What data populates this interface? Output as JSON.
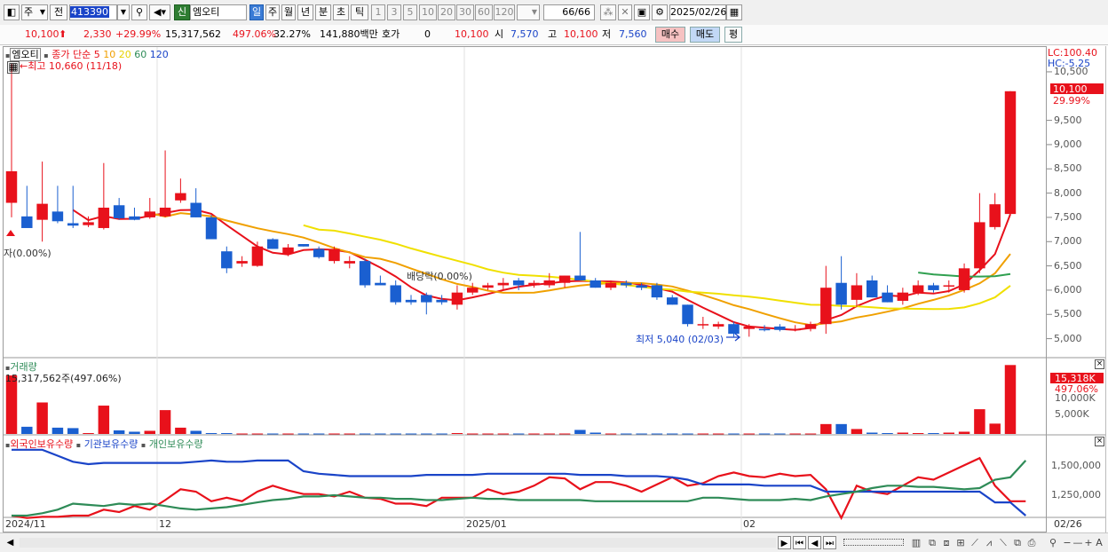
{
  "toolbar": {
    "mode": "주",
    "prev_label": "전",
    "code": "413390",
    "badge": "신",
    "name": "엠오티",
    "periods": [
      "일",
      "주",
      "월",
      "년",
      "분",
      "초",
      "틱"
    ],
    "selected_period": "일",
    "numbers": [
      "1",
      "3",
      "5",
      "10",
      "20",
      "30",
      "60",
      "120"
    ],
    "count": "66/66",
    "date": "2025/02/26"
  },
  "infobar": {
    "price": "10,100",
    "change": "2,330",
    "change_pct": "+29.99%",
    "volume": "15,317,562",
    "volume_pct": "497.06%",
    "turnover_pct": "32.27%",
    "amount": "141,880백만",
    "quote_label": "호가",
    "quote_value": "0",
    "close_value": "10,100",
    "open_label": "시",
    "open_value": "7,570",
    "high_label": "고",
    "high_value": "10,100",
    "low_label": "저",
    "low_value": "7,560",
    "buy_label": "매수",
    "sell_label": "매도",
    "eval_label": "평"
  },
  "price_pane": {
    "legend_name": "엠오티",
    "legend_ma_label": "종가 단순",
    "ma_periods": [
      "5",
      "10",
      "20",
      "60",
      "120"
    ],
    "ma_colors": [
      "#e8111b",
      "#f0a000",
      "#f0e000",
      "#30a050",
      "#1a44c8"
    ],
    "lc": "LC:100.40",
    "hc": "HC:-5.25",
    "high_annotation": "←최고 10,660 (11/18)",
    "low_annotation": "최저 5,040 (02/03)",
    "left_annotation": "자(0.00%)",
    "dividend_annotation": "배당락(0.00%)",
    "current_price": "10,100",
    "current_pct": "29.99%",
    "y_ticks": [
      "10,500",
      "9,500",
      "9,000",
      "8,500",
      "8,000",
      "7,500",
      "7,000",
      "6,500",
      "6,000",
      "5,500",
      "5,000"
    ]
  },
  "volume_pane": {
    "title": "거래량",
    "value_label": "15,317,562주(497.06%)",
    "current": "15,318K",
    "current_pct": "497.06%",
    "y_ticks": [
      "10,000K",
      "5,000K"
    ]
  },
  "holdings_pane": {
    "series": [
      "외국인보유수량",
      "기관보유수량",
      "개인보유수량"
    ],
    "colors": [
      "#e8111b",
      "#1a44c8",
      "#2e8b57"
    ],
    "y_ticks": [
      "1,500,000",
      "1,250,000"
    ]
  },
  "x_axis": {
    "labels": [
      "2024/11",
      "12",
      "2025/01",
      "02"
    ],
    "end_label": "02/26"
  },
  "chart_data": {
    "type": "candlestick",
    "candles": [
      {
        "d": "11/14",
        "o": 7800,
        "h": 10660,
        "l": 7500,
        "c": 8450
      },
      {
        "d": "11/15",
        "o": 7520,
        "h": 8150,
        "l": 7350,
        "c": 7280
      },
      {
        "d": "11/18",
        "o": 7450,
        "h": 8650,
        "l": 7000,
        "c": 7780
      },
      {
        "d": "11/19",
        "o": 7620,
        "h": 8150,
        "l": 7380,
        "c": 7420
      },
      {
        "d": "11/20",
        "o": 7380,
        "h": 8150,
        "l": 7280,
        "c": 7330
      },
      {
        "d": "11/21",
        "o": 7340,
        "h": 7520,
        "l": 7300,
        "c": 7400
      },
      {
        "d": "11/22",
        "o": 7280,
        "h": 8620,
        "l": 7250,
        "c": 7700
      },
      {
        "d": "11/25",
        "o": 7750,
        "h": 7900,
        "l": 7450,
        "c": 7480
      },
      {
        "d": "11/26",
        "o": 7520,
        "h": 7700,
        "l": 7440,
        "c": 7450
      },
      {
        "d": "11/27",
        "o": 7500,
        "h": 7900,
        "l": 7470,
        "c": 7620
      },
      {
        "d": "11/28",
        "o": 7520,
        "h": 8880,
        "l": 7500,
        "c": 7700
      },
      {
        "d": "11/29",
        "o": 7850,
        "h": 8300,
        "l": 7800,
        "c": 8000
      },
      {
        "d": "12/02",
        "o": 7800,
        "h": 8100,
        "l": 7500,
        "c": 7500
      },
      {
        "d": "12/03",
        "o": 7500,
        "h": 7550,
        "l": 7140,
        "c": 7050
      },
      {
        "d": "12/04",
        "o": 6800,
        "h": 6900,
        "l": 6350,
        "c": 6450
      },
      {
        "d": "12/05",
        "o": 6550,
        "h": 6700,
        "l": 6480,
        "c": 6600
      },
      {
        "d": "12/06",
        "o": 6500,
        "h": 7000,
        "l": 6480,
        "c": 6900
      },
      {
        "d": "12/09",
        "o": 7050,
        "h": 7070,
        "l": 6850,
        "c": 6850
      },
      {
        "d": "12/10",
        "o": 6750,
        "h": 6950,
        "l": 6700,
        "c": 6880
      },
      {
        "d": "12/11",
        "o": 6950,
        "h": 6950,
        "l": 6900,
        "c": 6900
      },
      {
        "d": "12/12",
        "o": 6850,
        "h": 6900,
        "l": 6650,
        "c": 6680
      },
      {
        "d": "12/13",
        "o": 6600,
        "h": 6900,
        "l": 6550,
        "c": 6850
      },
      {
        "d": "12/16",
        "o": 6550,
        "h": 6700,
        "l": 6450,
        "c": 6600
      },
      {
        "d": "12/17",
        "o": 6600,
        "h": 6650,
        "l": 6050,
        "c": 6100
      },
      {
        "d": "12/18",
        "o": 6150,
        "h": 6300,
        "l": 6100,
        "c": 6100
      },
      {
        "d": "12/19",
        "o": 6100,
        "h": 6200,
        "l": 5700,
        "c": 5750
      },
      {
        "d": "12/20",
        "o": 5800,
        "h": 5900,
        "l": 5700,
        "c": 5750
      },
      {
        "d": "12/23",
        "o": 5900,
        "h": 5950,
        "l": 5500,
        "c": 5750
      },
      {
        "d": "12/24",
        "o": 5800,
        "h": 5900,
        "l": 5700,
        "c": 5750
      },
      {
        "d": "12/26",
        "o": 5700,
        "h": 6100,
        "l": 5600,
        "c": 5950
      },
      {
        "d": "12/27",
        "o": 5950,
        "h": 6150,
        "l": 5900,
        "c": 6050
      },
      {
        "d": "12/30",
        "o": 6050,
        "h": 6150,
        "l": 6000,
        "c": 6100
      },
      {
        "d": "01/02",
        "o": 6100,
        "h": 6250,
        "l": 6000,
        "c": 6150
      },
      {
        "d": "01/03",
        "o": 6200,
        "h": 6250,
        "l": 6000,
        "c": 6100
      },
      {
        "d": "01/06",
        "o": 6100,
        "h": 6200,
        "l": 6050,
        "c": 6150
      },
      {
        "d": "01/07",
        "o": 6100,
        "h": 6350,
        "l": 6050,
        "c": 6200
      },
      {
        "d": "01/08",
        "o": 6150,
        "h": 6300,
        "l": 6050,
        "c": 6300
      },
      {
        "d": "01/09",
        "o": 6300,
        "h": 7200,
        "l": 6200,
        "c": 6200
      },
      {
        "d": "01/10",
        "o": 6200,
        "h": 6250,
        "l": 6050,
        "c": 6050
      },
      {
        "d": "01/13",
        "o": 6050,
        "h": 6200,
        "l": 6000,
        "c": 6150
      },
      {
        "d": "01/14",
        "o": 6150,
        "h": 6200,
        "l": 6050,
        "c": 6100
      },
      {
        "d": "01/15",
        "o": 6100,
        "h": 6150,
        "l": 6000,
        "c": 6050
      },
      {
        "d": "01/16",
        "o": 6100,
        "h": 6150,
        "l": 5800,
        "c": 5850
      },
      {
        "d": "01/17",
        "o": 5850,
        "h": 5900,
        "l": 5700,
        "c": 5700
      },
      {
        "d": "01/20",
        "o": 5700,
        "h": 5700,
        "l": 5250,
        "c": 5300
      },
      {
        "d": "01/21",
        "o": 5300,
        "h": 5450,
        "l": 5200,
        "c": 5300
      },
      {
        "d": "01/22",
        "o": 5250,
        "h": 5350,
        "l": 5200,
        "c": 5300
      },
      {
        "d": "01/23",
        "o": 5300,
        "h": 5350,
        "l": 5040,
        "c": 5100
      },
      {
        "d": "02/03",
        "o": 5200,
        "h": 5300,
        "l": 5040,
        "c": 5250
      },
      {
        "d": "02/04",
        "o": 5200,
        "h": 5280,
        "l": 5150,
        "c": 5180
      },
      {
        "d": "02/05",
        "o": 5250,
        "h": 5300,
        "l": 5150,
        "c": 5180
      },
      {
        "d": "02/06",
        "o": 5200,
        "h": 5280,
        "l": 5150,
        "c": 5200
      },
      {
        "d": "02/07",
        "o": 5200,
        "h": 5350,
        "l": 5150,
        "c": 5300
      },
      {
        "d": "02/10",
        "o": 5300,
        "h": 6500,
        "l": 5100,
        "c": 6050
      },
      {
        "d": "02/11",
        "o": 6150,
        "h": 6700,
        "l": 5600,
        "c": 5700
      },
      {
        "d": "02/12",
        "o": 5800,
        "h": 6350,
        "l": 5650,
        "c": 6100
      },
      {
        "d": "02/13",
        "o": 6200,
        "h": 6300,
        "l": 5850,
        "c": 5850
      },
      {
        "d": "02/14",
        "o": 5950,
        "h": 6100,
        "l": 5750,
        "c": 5750
      },
      {
        "d": "02/17",
        "o": 5780,
        "h": 6050,
        "l": 5700,
        "c": 5950
      },
      {
        "d": "02/18",
        "o": 5950,
        "h": 6200,
        "l": 5900,
        "c": 6100
      },
      {
        "d": "02/19",
        "o": 6100,
        "h": 6150,
        "l": 5950,
        "c": 6000
      },
      {
        "d": "02/20",
        "o": 6100,
        "h": 6200,
        "l": 5950,
        "c": 6100
      },
      {
        "d": "02/21",
        "o": 6000,
        "h": 6550,
        "l": 5950,
        "c": 6450
      },
      {
        "d": "02/24",
        "o": 6450,
        "h": 8000,
        "l": 6350,
        "c": 7400
      },
      {
        "d": "02/25",
        "o": 7300,
        "h": 8000,
        "l": 7250,
        "c": 7770
      },
      {
        "d": "02/26",
        "o": 7570,
        "h": 10100,
        "l": 7560,
        "c": 10100
      }
    ],
    "volume_k": [
      13000,
      1600,
      7000,
      1400,
      1300,
      200,
      6300,
      800,
      500,
      700,
      5300,
      1400,
      700,
      200,
      200,
      100,
      100,
      100,
      100,
      100,
      100,
      100,
      100,
      100,
      100,
      100,
      100,
      100,
      100,
      200,
      100,
      100,
      100,
      100,
      100,
      100,
      100,
      900,
      300,
      100,
      100,
      100,
      100,
      100,
      100,
      100,
      100,
      100,
      100,
      100,
      100,
      100,
      100,
      2200,
      2200,
      1100,
      300,
      200,
      300,
      200,
      200,
      300,
      500,
      5500,
      2300,
      15318
    ],
    "y_range": [
      4700,
      10700
    ],
    "volume_range": [
      0,
      14000
    ],
    "holdings": {
      "foreign": [
        1100000,
        1080000,
        1090000,
        1090000,
        1100000,
        1100000,
        1150000,
        1130000,
        1180000,
        1150000,
        1230000,
        1320000,
        1300000,
        1220000,
        1250000,
        1220000,
        1300000,
        1350000,
        1310000,
        1280000,
        1280000,
        1260000,
        1300000,
        1250000,
        1240000,
        1200000,
        1200000,
        1180000,
        1250000,
        1250000,
        1250000,
        1320000,
        1280000,
        1300000,
        1350000,
        1420000,
        1410000,
        1320000,
        1380000,
        1380000,
        1350000,
        1300000,
        1360000,
        1420000,
        1350000,
        1370000,
        1430000,
        1460000,
        1430000,
        1420000,
        1450000,
        1430000,
        1440000,
        1320000,
        1080000,
        1350000,
        1300000,
        1280000,
        1350000,
        1420000,
        1400000,
        1460000,
        1520000,
        1580000,
        1350000,
        1220000,
        1220000
      ],
      "institution": [
        1650000,
        1650000,
        1650000,
        1600000,
        1550000,
        1530000,
        1540000,
        1540000,
        1540000,
        1540000,
        1540000,
        1540000,
        1550000,
        1560000,
        1550000,
        1550000,
        1560000,
        1560000,
        1560000,
        1470000,
        1450000,
        1440000,
        1430000,
        1430000,
        1430000,
        1430000,
        1430000,
        1440000,
        1440000,
        1440000,
        1440000,
        1450000,
        1450000,
        1450000,
        1450000,
        1450000,
        1450000,
        1440000,
        1440000,
        1440000,
        1430000,
        1430000,
        1430000,
        1420000,
        1400000,
        1360000,
        1360000,
        1360000,
        1360000,
        1350000,
        1350000,
        1350000,
        1350000,
        1300000,
        1300000,
        1300000,
        1300000,
        1300000,
        1300000,
        1300000,
        1300000,
        1300000,
        1300000,
        1300000,
        1210000,
        1210000,
        1100000
      ],
      "individual": [
        1100000,
        1100000,
        1120000,
        1150000,
        1200000,
        1190000,
        1180000,
        1200000,
        1190000,
        1200000,
        1180000,
        1160000,
        1150000,
        1160000,
        1170000,
        1190000,
        1210000,
        1230000,
        1240000,
        1260000,
        1260000,
        1270000,
        1260000,
        1250000,
        1250000,
        1240000,
        1240000,
        1230000,
        1230000,
        1240000,
        1250000,
        1240000,
        1240000,
        1230000,
        1230000,
        1230000,
        1230000,
        1230000,
        1220000,
        1220000,
        1220000,
        1220000,
        1220000,
        1220000,
        1220000,
        1250000,
        1250000,
        1240000,
        1230000,
        1230000,
        1230000,
        1240000,
        1230000,
        1260000,
        1280000,
        1300000,
        1330000,
        1350000,
        1350000,
        1340000,
        1340000,
        1330000,
        1320000,
        1330000,
        1400000,
        1420000,
        1560000
      ]
    },
    "holdings_range": [
      1100000,
      1700000
    ]
  }
}
